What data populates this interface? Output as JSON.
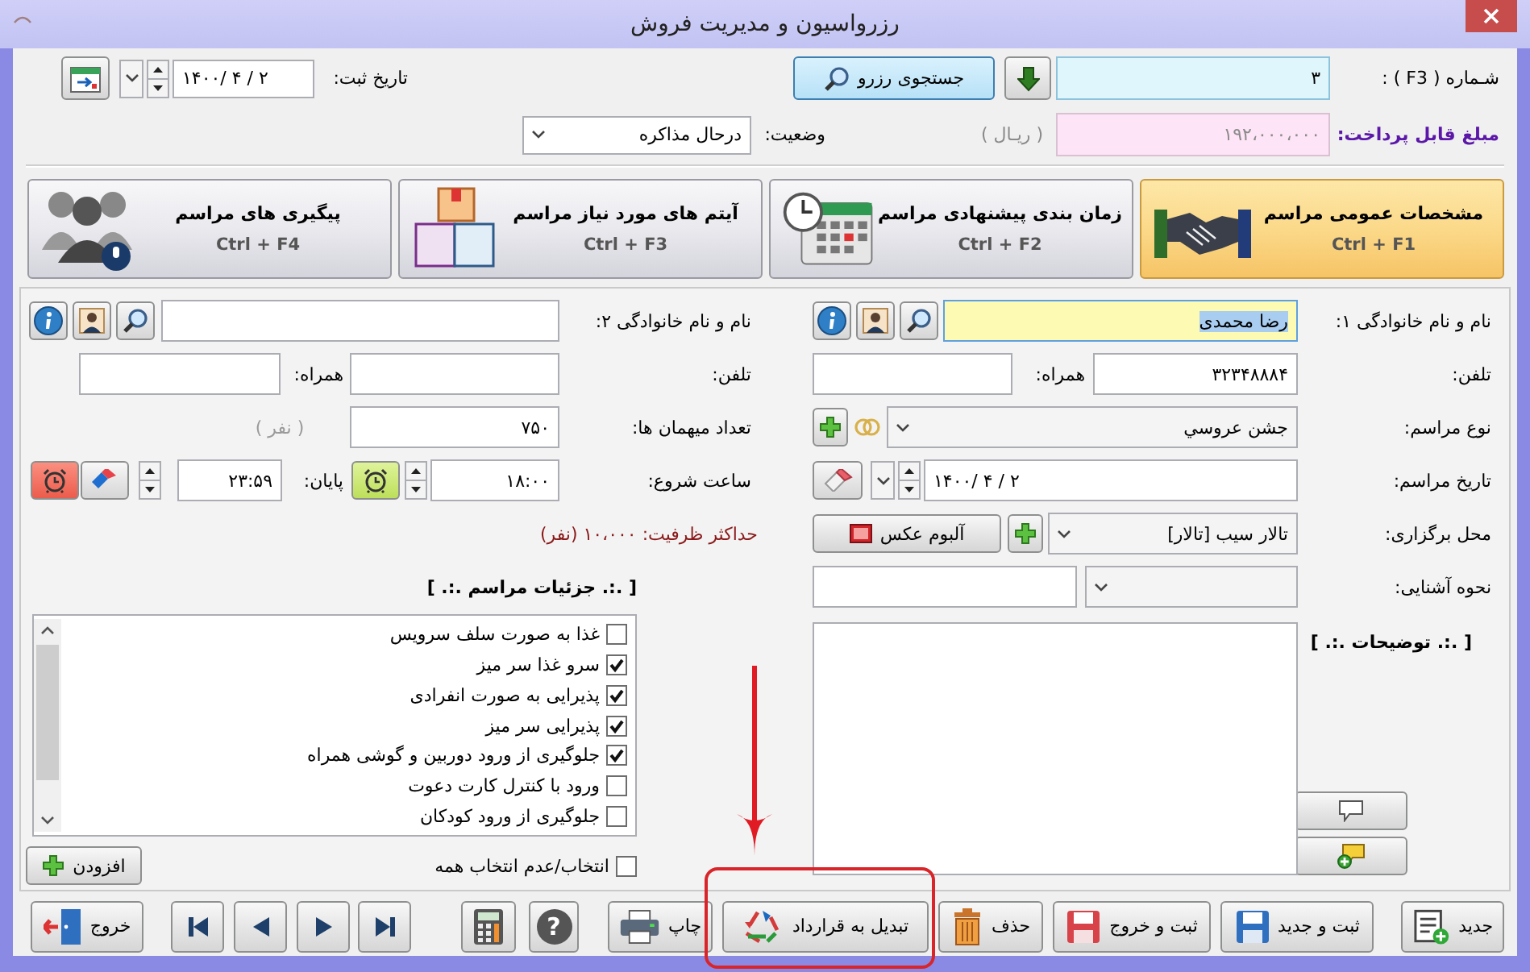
{
  "window": {
    "title": "رزرواسیون و مدیریت فروش"
  },
  "header": {
    "number_label": "شـماره ( F3 ) :",
    "number": "۳",
    "search_button": "جستجوی رزرو",
    "date_label": "تاریخ ثبت:",
    "date": "۱۴۰۰/ ۴ / ۲",
    "payable_label": "مبلغ قابل پرداخت:",
    "payable": "۱۹۲،۰۰۰،۰۰۰",
    "currency": "( ریـال )",
    "status_label": "وضعیت:",
    "status": "درحال مذاکره"
  },
  "tabs": [
    {
      "kind": "handshake",
      "title": "مشخصات عمومی مراسم",
      "shortcut": "Ctrl + F1",
      "selected": true
    },
    {
      "kind": "schedule",
      "title": "زمان بندی پیشنهادی مراسم",
      "shortcut": "Ctrl + F2",
      "selected": false
    },
    {
      "kind": "boxes",
      "title": "آیتم های مورد نیاز مراسم",
      "shortcut": "Ctrl + F3",
      "selected": false
    },
    {
      "kind": "people",
      "title": "پیگیری های مراسم",
      "shortcut": "Ctrl + F4",
      "selected": false
    }
  ],
  "party_1": {
    "name_label": "نام و نام خانوادگی ۱:",
    "name": "رضا محمدی",
    "name_focused": true,
    "phone_label": "تلفن:",
    "phone": "۳۲۳۴۸۸۸۴",
    "mobile_label": "همراه:",
    "type_label": "نوع مراسم:",
    "type": "جشن عروسي",
    "date_label": "تاریخ مراسم:",
    "date": "۱۴۰۰/ ۴ / ۲",
    "venue_label": "محل برگزاری:",
    "venue": "تالار سیب [تالار]",
    "album_button": "آلبوم عکس",
    "referral_label": "نحوه آشنایی:",
    "notes_label": "[ .:. توضیحات .:. ]"
  },
  "party_2": {
    "name_label": "نام و نام خانوادگی ۲:",
    "phone_label": "تلفن:",
    "mobile_label": "همراه:",
    "guests_label": "تعداد میهمان ها:",
    "guests": "۷۵۰",
    "guests_unit": "( نفر )",
    "start_label": "ساعت شروع:",
    "start": "۱۸:۰۰",
    "end_label": "پایان:",
    "end": "۲۳:۵۹",
    "capacity": "حداکثر ظرفیت: ۱۰،۰۰۰ (نفر)",
    "details_label": "[ .:. جزئیات مراسم .:. ]",
    "details": [
      {
        "label": "غذا به صورت سلف سرویس",
        "checked": false
      },
      {
        "label": "سرو غذا سر میز",
        "checked": true
      },
      {
        "label": "پذیرایی به صورت انفرادی",
        "checked": true
      },
      {
        "label": "پذیرایی سر میز",
        "checked": true
      },
      {
        "label": "جلوگیری از ورود دوربین و گوشی همراه",
        "checked": true
      },
      {
        "label": "ورود با کنترل کارت دعوت",
        "checked": false
      },
      {
        "label": "جلوگیری از ورود کودکان",
        "checked": false
      }
    ],
    "select_all": {
      "label": "انتخاب/عدم انتخاب همه",
      "checked": false
    },
    "add_button": "افزودن"
  },
  "toolbar": [
    {
      "kind": "new",
      "label": "جدید"
    },
    {
      "kind": "save_new",
      "label": "ثبت و جدید"
    },
    {
      "kind": "save_exit",
      "label": "ثبت و خروج"
    },
    {
      "kind": "delete",
      "label": "حذف"
    },
    {
      "kind": "convert",
      "label": "تبدیل به قرارداد"
    },
    {
      "kind": "print",
      "label": "چاپ"
    },
    {
      "kind": "help",
      "label": "?"
    },
    {
      "kind": "calculator"
    },
    {
      "kind": "last"
    },
    {
      "kind": "next"
    },
    {
      "kind": "previous"
    },
    {
      "kind": "first"
    },
    {
      "kind": "exit",
      "label": "خروج"
    }
  ]
}
